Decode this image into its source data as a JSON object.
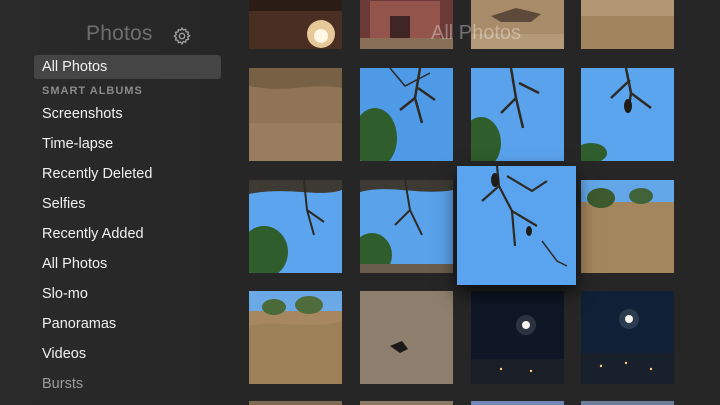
{
  "sidebar": {
    "title": "Photos",
    "settings_icon": "gear-icon",
    "selected_item": "All Photos",
    "section_label": "SMART ALBUMS",
    "items": [
      "Screenshots",
      "Time-lapse",
      "Recently Deleted",
      "Selfies",
      "Recently Added",
      "All Photos",
      "Slo-mo",
      "Panoramas",
      "Videos",
      "Bursts"
    ]
  },
  "content": {
    "title": "All Photos"
  },
  "colors": {
    "background": "#262626",
    "selected_row": "#454545",
    "sky": "#5da3ea",
    "dirt": "#a8885f",
    "night": "#101828"
  }
}
